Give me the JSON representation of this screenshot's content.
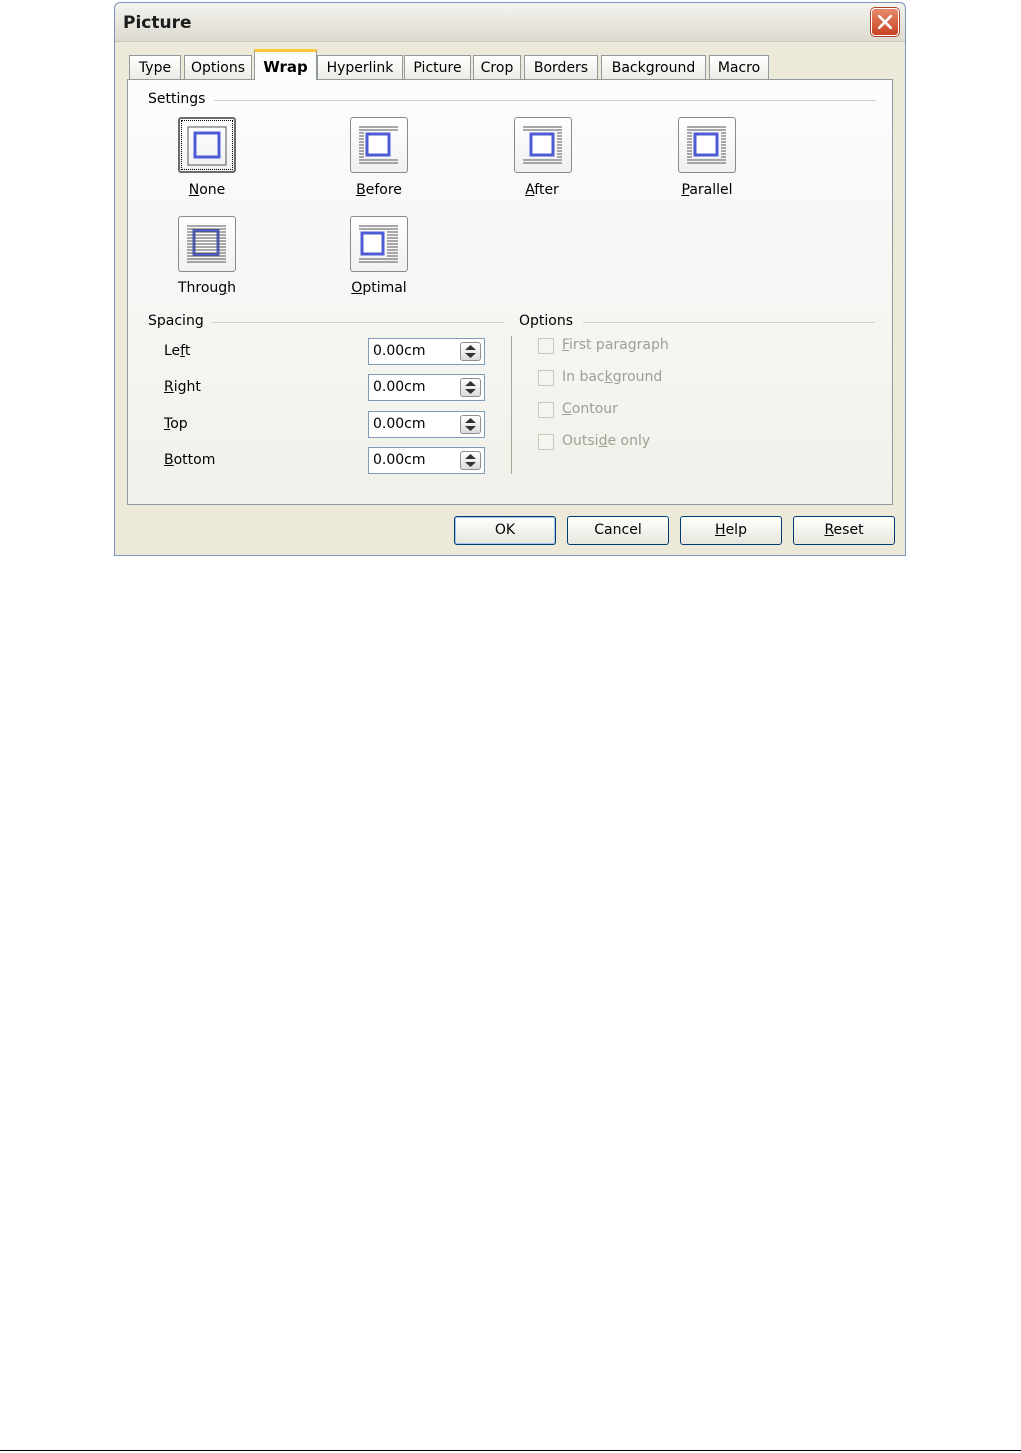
{
  "dialog": {
    "title": "Picture",
    "close_icon": "close-icon"
  },
  "tabs": [
    {
      "label": "Type"
    },
    {
      "label": "Options"
    },
    {
      "label": "Wrap",
      "active": true
    },
    {
      "label": "Hyperlink"
    },
    {
      "label": "Picture"
    },
    {
      "label": "Crop"
    },
    {
      "label": "Borders"
    },
    {
      "label": "Background"
    },
    {
      "label": "Macro"
    }
  ],
  "settings": {
    "heading": "Settings",
    "selected": "None",
    "items": [
      {
        "pre": "",
        "acc": "N",
        "post": "one",
        "icon": "wrap-none-icon"
      },
      {
        "pre": "",
        "acc": "B",
        "post": "efore",
        "icon": "wrap-before-icon"
      },
      {
        "pre": "",
        "acc": "A",
        "post": "fter",
        "icon": "wrap-after-icon"
      },
      {
        "pre": "",
        "acc": "P",
        "post": "arallel",
        "icon": "wrap-parallel-icon"
      },
      {
        "pre": "Throu",
        "acc": "g",
        "post": "h",
        "icon": "wrap-through-icon"
      },
      {
        "pre": "",
        "acc": "O",
        "post": "ptimal",
        "icon": "wrap-optimal-icon"
      }
    ]
  },
  "spacing": {
    "heading": "Spacing",
    "rows": [
      {
        "pre": "Le",
        "acc": "f",
        "post": "t",
        "value": "0.00cm"
      },
      {
        "pre": "",
        "acc": "R",
        "post": "ight",
        "value": "0.00cm"
      },
      {
        "pre": "",
        "acc": "T",
        "post": "op",
        "value": "0.00cm"
      },
      {
        "pre": "",
        "acc": "B",
        "post": "ottom",
        "value": "0.00cm"
      }
    ]
  },
  "options": {
    "heading": "Options",
    "items": [
      {
        "pre": "",
        "acc": "F",
        "post": "irst paragraph",
        "checked": false,
        "enabled": false
      },
      {
        "pre": "In bac",
        "acc": "k",
        "post": "ground",
        "checked": false,
        "enabled": false
      },
      {
        "pre": "",
        "acc": "C",
        "post": "ontour",
        "checked": false,
        "enabled": false
      },
      {
        "pre": "Outsi",
        "acc": "d",
        "post": "e only",
        "checked": false,
        "enabled": false
      }
    ]
  },
  "buttons": {
    "ok": {
      "pre": "OK",
      "acc": "",
      "post": ""
    },
    "cancel": {
      "pre": "Cancel",
      "acc": "",
      "post": ""
    },
    "help": {
      "pre": "",
      "acc": "H",
      "post": "elp"
    },
    "reset": {
      "pre": "",
      "acc": "R",
      "post": "eset"
    }
  }
}
